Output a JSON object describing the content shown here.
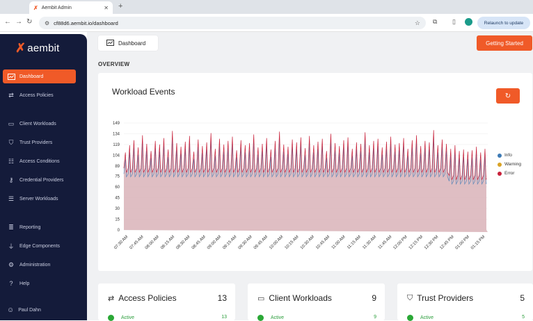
{
  "browser": {
    "tab_title": "Aembit Admin",
    "url": "cf88d6.aembit.io/dashboard",
    "relaunch_label": "Relaunch to update"
  },
  "sidebar": {
    "brand": "aembit",
    "items": [
      {
        "label": "Dashboard",
        "icon": "chart-window-icon",
        "active": true
      },
      {
        "label": "Access Policies",
        "icon": "arrows-swap-icon"
      },
      {
        "label": "Client Workloads",
        "icon": "monitor-icon"
      },
      {
        "label": "Trust Providers",
        "icon": "shield-check-icon"
      },
      {
        "label": "Access Conditions",
        "icon": "checklist-icon"
      },
      {
        "label": "Credential Providers",
        "icon": "key-icon"
      },
      {
        "label": "Server Workloads",
        "icon": "server-icon"
      },
      {
        "label": "Reporting",
        "icon": "list-icon"
      },
      {
        "label": "Edge Components",
        "icon": "plug-icon"
      },
      {
        "label": "Administration",
        "icon": "gear-icon"
      },
      {
        "label": "Help",
        "icon": "help-icon"
      }
    ],
    "user": "Paul Dahn"
  },
  "header": {
    "dashboard_label": "Dashboard",
    "getting_started": "Getting Started",
    "overview": "OVERVIEW"
  },
  "chart_card": {
    "title": "Workload Events"
  },
  "chart_data": {
    "type": "area",
    "title": "Workload Events",
    "y_ticks": [
      0,
      15,
      30,
      45,
      60,
      75,
      89,
      104,
      119,
      134,
      149
    ],
    "ylim": [
      0,
      149
    ],
    "x_ticks": [
      "07:30 AM",
      "07:45 AM",
      "08:00 AM",
      "08:15 AM",
      "08:30 AM",
      "08:45 AM",
      "09:00 AM",
      "09:15 AM",
      "09:30 AM",
      "09:45 AM",
      "10:00 AM",
      "10:15 AM",
      "10:30 AM",
      "10:45 AM",
      "11:00 AM",
      "11:15 AM",
      "11:30 AM",
      "11:45 AM",
      "12:00 PM",
      "12:15 PM",
      "12:30 PM",
      "12:45 PM",
      "01:00 PM",
      "01:15 PM"
    ],
    "series": [
      {
        "name": "Info",
        "color": "#3d7ab5"
      },
      {
        "name": "Warning",
        "color": "#d9a326"
      },
      {
        "name": "Error",
        "color": "#c8213a"
      }
    ],
    "baseline": 82,
    "late_baseline": 72,
    "spike_peaks": [
      108,
      118,
      125,
      115,
      132,
      120,
      110,
      124,
      119,
      128,
      112,
      138,
      121,
      116,
      123,
      131,
      109,
      126,
      117,
      122,
      135,
      113,
      127,
      119,
      124,
      130,
      111,
      125,
      118,
      121,
      133,
      115,
      120,
      128,
      112,
      124,
      137,
      119,
      116,
      126,
      122,
      129,
      114,
      131,
      118,
      123,
      127,
      110,
      134,
      121,
      117,
      125,
      129,
      113,
      122,
      120,
      136,
      118,
      124,
      127,
      115,
      123,
      130,
      119,
      121,
      128,
      113,
      125,
      132,
      117,
      124,
      122,
      139,
      118,
      126,
      120,
      113,
      118,
      110,
      112,
      109,
      111,
      116,
      108,
      113
    ],
    "legend_position": "right"
  },
  "stats": [
    {
      "title": "Access Policies",
      "count": "13",
      "icon": "arrows-swap-icon",
      "sub_label": "Active",
      "sub_count": "13"
    },
    {
      "title": "Client Workloads",
      "count": "9",
      "icon": "monitor-icon",
      "sub_label": "Active",
      "sub_count": "9"
    },
    {
      "title": "Trust Providers",
      "count": "5",
      "icon": "shield-check-icon",
      "sub_label": "Active",
      "sub_count": "5"
    }
  ]
}
